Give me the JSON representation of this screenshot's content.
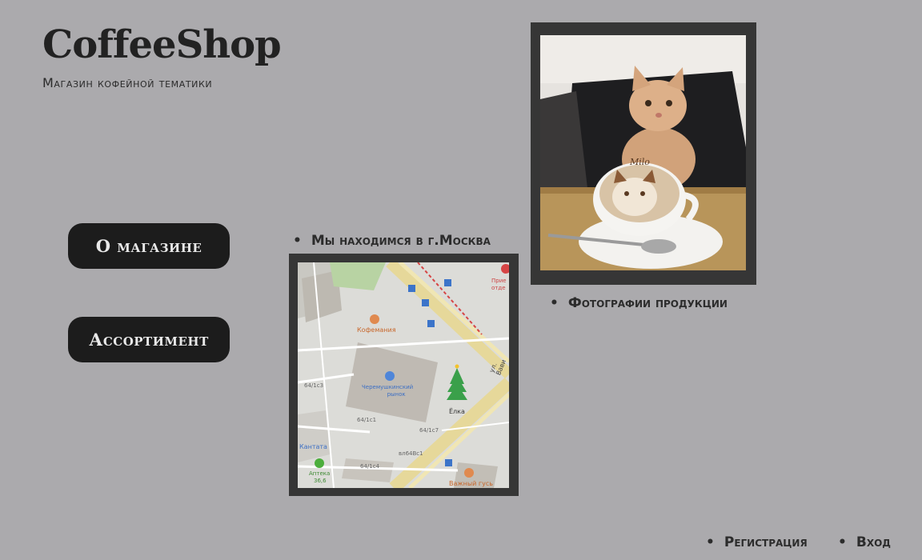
{
  "header": {
    "logo": "CoffeeShop",
    "tagline": "Магазин кофейной тематики"
  },
  "nav": {
    "about_label": "О магазине",
    "assortment_label": "Ассортимент"
  },
  "location": {
    "caption": "Мы находимся в г.Москва",
    "map_labels": {
      "coffee": "Кофемания",
      "market_line1": "Черемушкинский",
      "market_line2": "рынок",
      "tree": "Ёлка",
      "kantata": "Кантата",
      "pharmacy_line1": "Аптека",
      "pharmacy_line2": "36,6",
      "goose": "Важный гусь",
      "street": "ул. Вави",
      "b1": "64/1с3",
      "b2": "64/1с1",
      "b3": "64/1с7",
      "b4": "64/1с4",
      "b5": "вл64Вс1",
      "corner1": "Прие",
      "corner2": "отде"
    }
  },
  "products": {
    "caption": "Фотографии продукции",
    "cup_text": "Milo"
  },
  "auth": {
    "register_label": "Регистрация",
    "login_label": "Вход"
  },
  "colors": {
    "background": "#abaaad",
    "button": "#1c1c1c",
    "frame": "#363636"
  }
}
